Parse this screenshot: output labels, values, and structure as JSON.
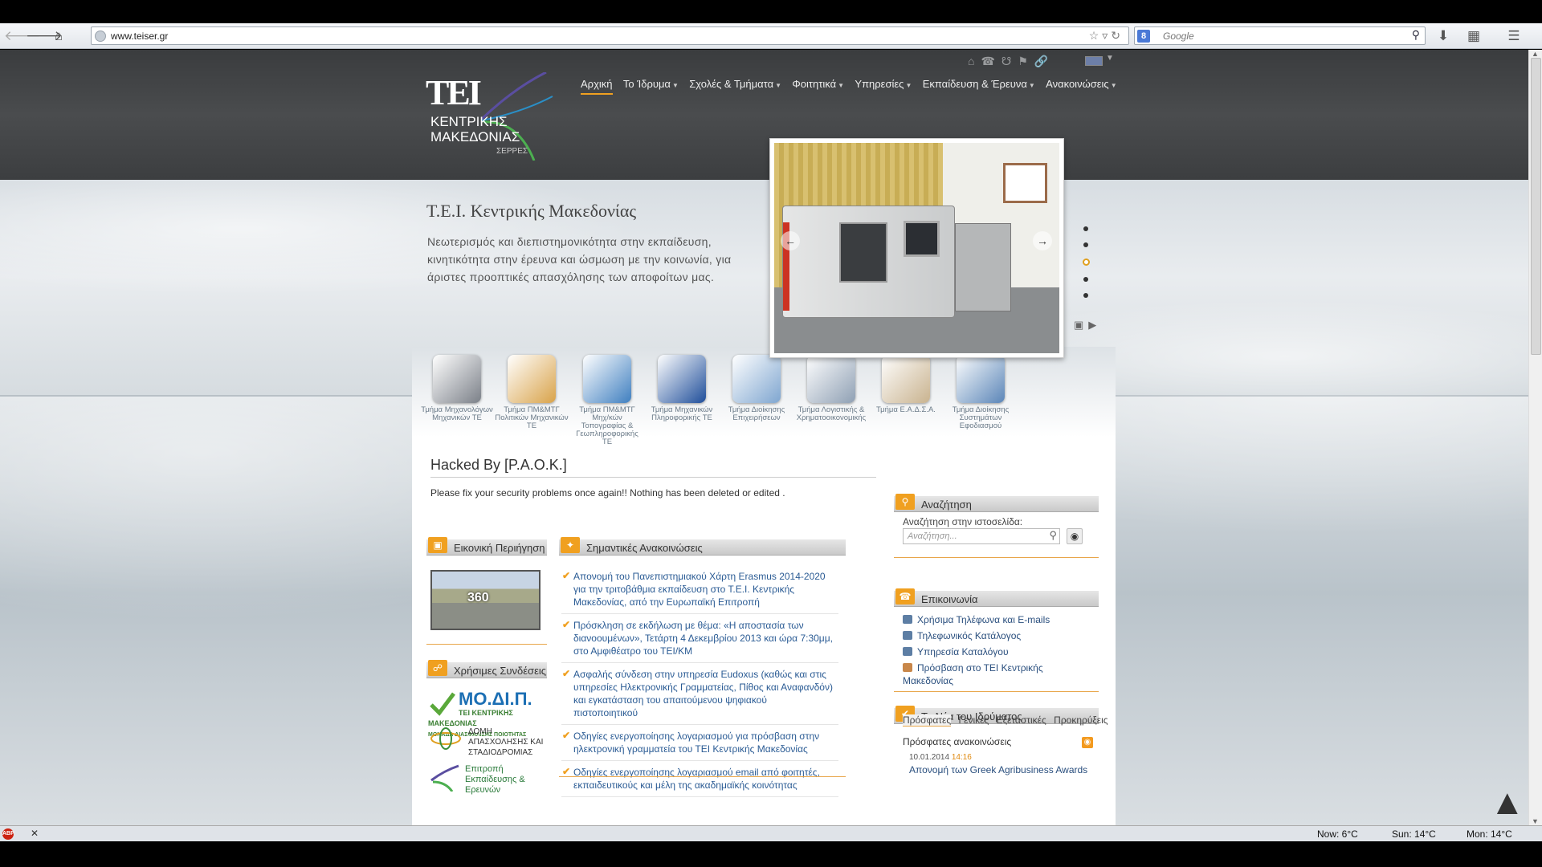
{
  "browser": {
    "url": "www.teiser.gr",
    "search_placeholder": "Google",
    "search_engine_letter": "8"
  },
  "header": {
    "logo": {
      "mark": "TEI",
      "line1": "ΚΕΝΤΡΙΚΗΣ",
      "line2": "ΜΑΚΕΔΟΝΙΑΣ",
      "line3": "ΣΕΡΡΕΣ"
    },
    "nav": [
      {
        "label": "Αρχική",
        "active": true
      },
      {
        "label": "Το Ίδρυμα"
      },
      {
        "label": "Σχολές & Τμήματα"
      },
      {
        "label": "Φοιτητικά"
      },
      {
        "label": "Υπηρεσίες"
      },
      {
        "label": "Εκπαίδευση & Έρευνα"
      },
      {
        "label": "Ανακοινώσεις"
      }
    ]
  },
  "hero": {
    "title": "Τ.Ε.Ι. Κεντρικής Μακεδονίας",
    "text": "Νεωτερισμός και διεπιστημονικότητα στην εκπαίδευση, κινητικότητα στην έρευνα και ώσμωση με την κοινωνία, για άριστες προοπτικές απασχόλησης των αποφοίτων μας.",
    "slider_dots": 5,
    "slider_active": 3
  },
  "departments": [
    {
      "label": "Τμήμα Μηχανολόγων Μηχανικών ΤΕ",
      "color": "#7b8088"
    },
    {
      "label": "Τμήμα ΠΜ&ΜΤΓ Πολιτικών Μηχανικών ΤΕ",
      "color": "#d9a34a"
    },
    {
      "label": "Τμήμα ΠΜ&ΜΤΓ Μηχ/κών Τοπογραφίας & Γεωπληροφορικής ΤΕ",
      "color": "#3f7fc0"
    },
    {
      "label": "Τμήμα Μηχανικών Πληροφορικής ΤΕ",
      "color": "#1f4e9a"
    },
    {
      "label": "Τμήμα Διοίκησης Επιχειρήσεων",
      "color": "#7fa6d0"
    },
    {
      "label": "Τμήμα Λογιστικής & Χρηματοοικονομικής",
      "color": "#8fa0b4"
    },
    {
      "label": "Τμήμα Ε.Α.Δ.Σ.Α.",
      "color": "#c9b38f"
    },
    {
      "label": "Τμήμα Διοίκησης Συστημάτων Εφοδιασμού",
      "color": "#5b86b8"
    }
  ],
  "main": {
    "hacked_title": "Hacked By [P.A.O.K.]",
    "hacked_text": "Please fix your security problems once again!! Nothing has been deleted or edited ."
  },
  "virtual_tour": {
    "title": "Εικονική Περιήγηση",
    "pano_label": "360"
  },
  "useful_links": {
    "title": "Χρήσιμες Συνδέσεις",
    "logos": [
      "ΜΟ.ΔΙ.Π.",
      "ΤΕΙ ΚΕΝΤΡΙΚΗΣ ΜΑΚΕΔΟΝΙΑΣ",
      "ΜΟΝΑΔΑ ΔΙΑΣΦΑΛΙΣΗΣ ΠΟΙΟΤΗΤΑΣ",
      "ΔΟΜΗ ΑΠΑΣΧΟΛΗΣΗΣ ΚΑΙ ΣΤΑΔΙΟΔΡΟΜΙΑΣ",
      "Επιτροπή Εκπαίδευσης & Ερευνών"
    ]
  },
  "announcements": {
    "title": "Σημαντικές Ανακοινώσεις",
    "items": [
      "Απονομή του Πανεπιστημιακού Χάρτη Erasmus 2014-2020 για την τριτοβάθμια εκπαίδευση στο Τ.Ε.Ι. Κεντρικής Μακεδονίας, από την Ευρωπαϊκή Επιτροπή",
      "Πρόσκληση σε εκδήλωση με θέμα: «Η αποστασία των διανοουμένων», Τετάρτη 4 Δεκεμβρίου 2013 και ώρα 7:30μμ, στο Αμφιθέατρο του ΤΕΙ/ΚΜ",
      "Ασφαλής σύνδεση στην υπηρεσία Eudoxus (καθώς και στις υπηρεσίες Ηλεκτρονικής Γραμματείας, Πίθος και Αναφανδόν) και εγκατάσταση του απαιτούμενου ψηφιακού πιστοποιητικού",
      "Οδηγίες ενεργοποίησης λογαριασμού για πρόσβαση στην ηλεκτρονική γραμματεία του ΤΕΙ Κεντρικής Μακεδονίας",
      "Οδηγίες ενεργοποίησης λογαριασμού email από φοιτητές, εκπαιδευτικούς και μέλη της ακαδημαϊκής κοινότητας"
    ]
  },
  "search": {
    "title": "Αναζήτηση",
    "label": "Αναζήτηση στην ιστοσελίδα:",
    "placeholder": "Αναζήτηση..."
  },
  "contact": {
    "title": "Επικοινωνία",
    "items": [
      "Χρήσιμα Τηλέφωνα και E-mails",
      "Τηλεφωνικός Κατάλογος",
      "Υπηρεσία Καταλόγου",
      "Πρόσβαση στο ΤΕΙ Κεντρικής Μακεδονίας"
    ]
  },
  "news": {
    "title": "Τα Νέα του Ιδρύματος",
    "tabs": [
      "Πρόσφατες",
      "Γενικές",
      "Εξεταστικές",
      "Προκηρύξεις"
    ],
    "recent_title": "Πρόσφατες ανακοινώσεις",
    "date": "10.01.2014",
    "time": "14:16",
    "headline": "Απονομή των Greek Agribusiness Awards"
  },
  "statusbar": {
    "abp": "ABP",
    "weather_now": "Now: 6°C",
    "weather_sun": "Sun: 14°C",
    "weather_mon": "Mon: 14°C"
  }
}
